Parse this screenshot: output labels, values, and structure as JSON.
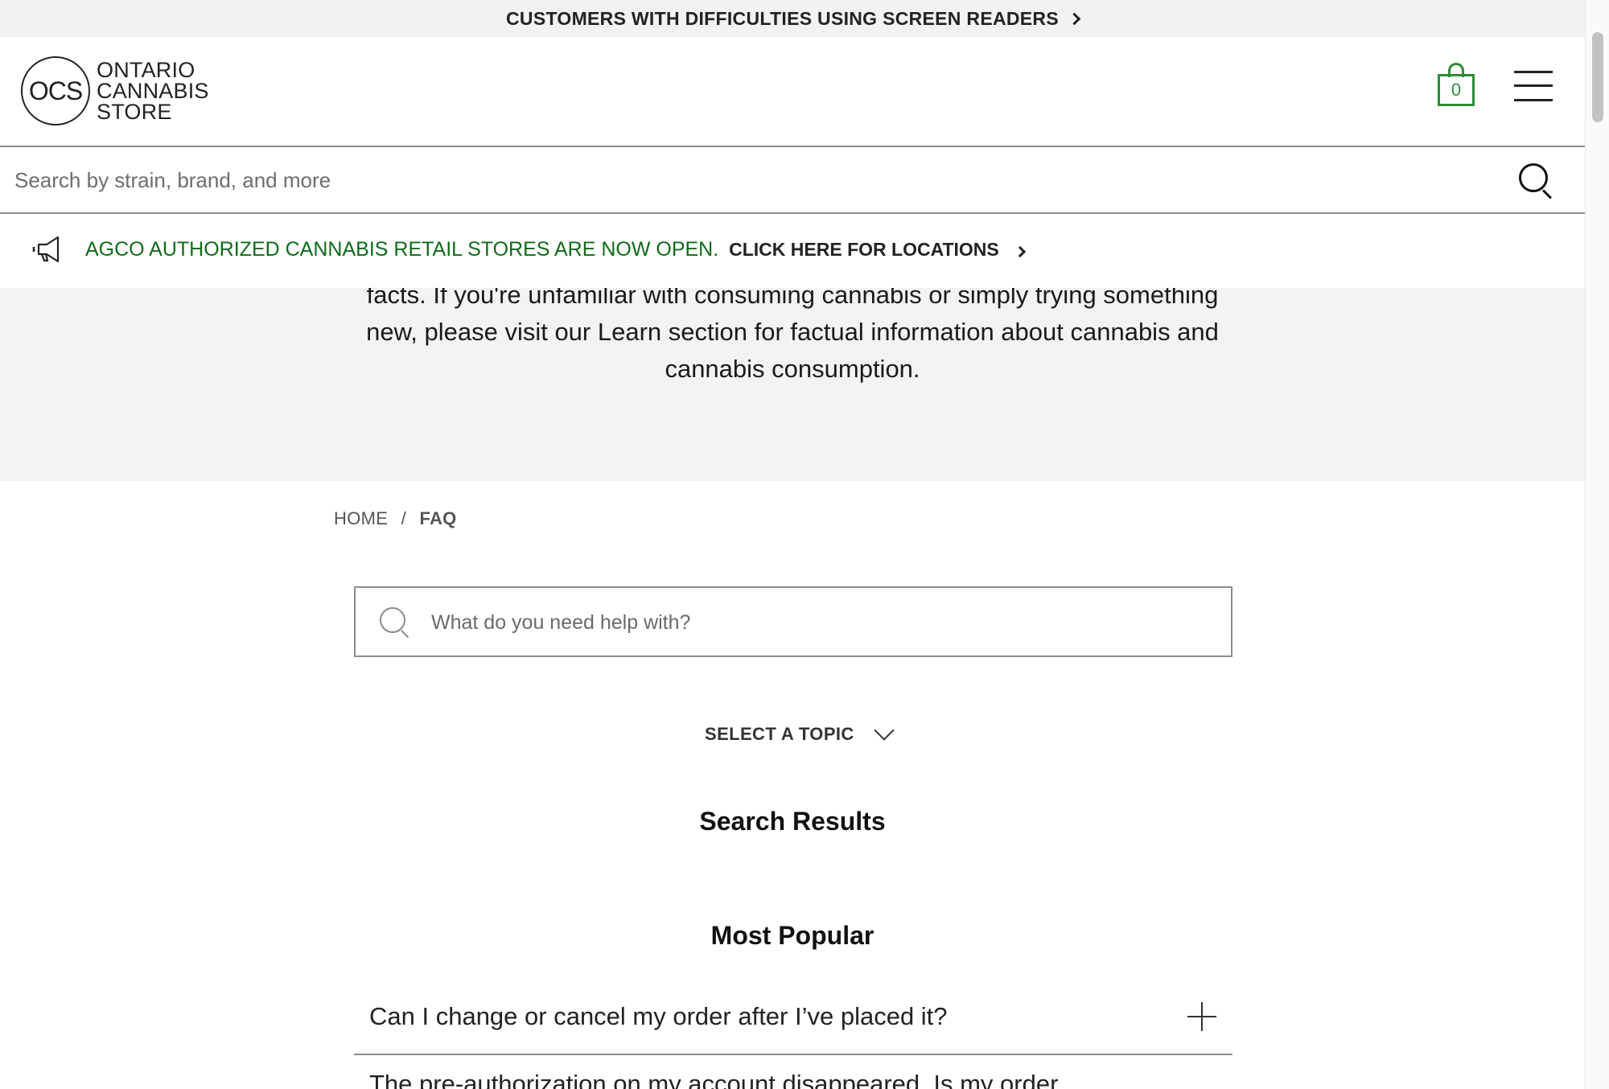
{
  "a11y_bar": {
    "text": "CUSTOMERS WITH DIFFICULTIES USING SCREEN READERS"
  },
  "header": {
    "logo_mark": "OCS",
    "logo_lines": [
      "ONTARIO",
      "CANNABIS",
      "STORE"
    ],
    "cart_count": "0",
    "accent_color": "#2e8b3a"
  },
  "site_search": {
    "placeholder": "Search by strain, brand, and more"
  },
  "announcement": {
    "text": "AGCO AUTHORIZED CANNABIS RETAIL STORES ARE NOW OPEN.",
    "link": "CLICK HERE FOR LOCATIONS",
    "color": "#0f6b1a"
  },
  "intro": {
    "lines": [
      "facts. If you're unfamiliar with consuming cannabis or simply trying something",
      "new, please visit our Learn section for factual information about cannabis and",
      "cannabis consumption."
    ]
  },
  "breadcrumb": {
    "home": "HOME",
    "separator": "/",
    "current": "FAQ"
  },
  "faq_search": {
    "placeholder": "What do you need help with?"
  },
  "topic_select": {
    "label": "SELECT A TOPIC"
  },
  "headings": {
    "results": "Search Results",
    "popular": "Most Popular"
  },
  "faq": [
    {
      "question": "Can I change or cancel my order after I’ve placed it?"
    },
    {
      "question": "The pre-authorization on my account disappeared. Is my order"
    }
  ]
}
